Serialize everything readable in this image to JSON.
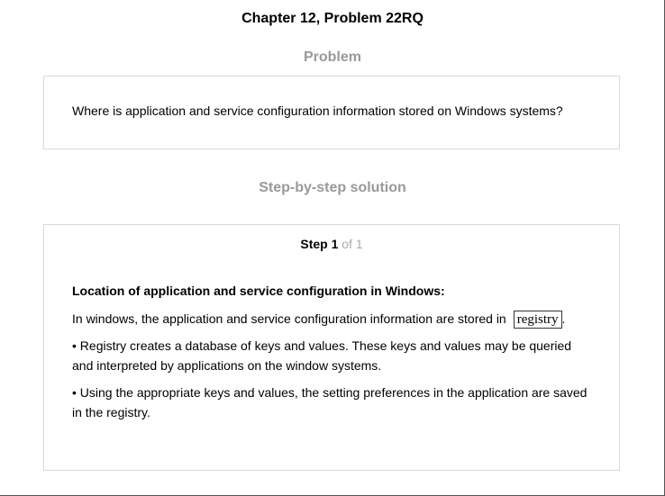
{
  "page_title": "Chapter 12, Problem 22RQ",
  "problem": {
    "heading": "Problem",
    "text": "Where is application and service configuration information stored on Windows systems?"
  },
  "solution": {
    "heading": "Step-by-step solution",
    "step_label": "Step 1",
    "step_of": "of 1",
    "content_heading": "Location of application and service configuration in Windows:",
    "intro": "In windows, the application and service configuration information are stored in",
    "answer": "registry",
    "intro_end": ".",
    "bullets": [
      "• Registry creates a database of keys and values. These keys and values may be queried and interpreted by applications on the window systems.",
      "• Using the appropriate keys and values, the setting preferences in the application are saved in the registry."
    ]
  }
}
